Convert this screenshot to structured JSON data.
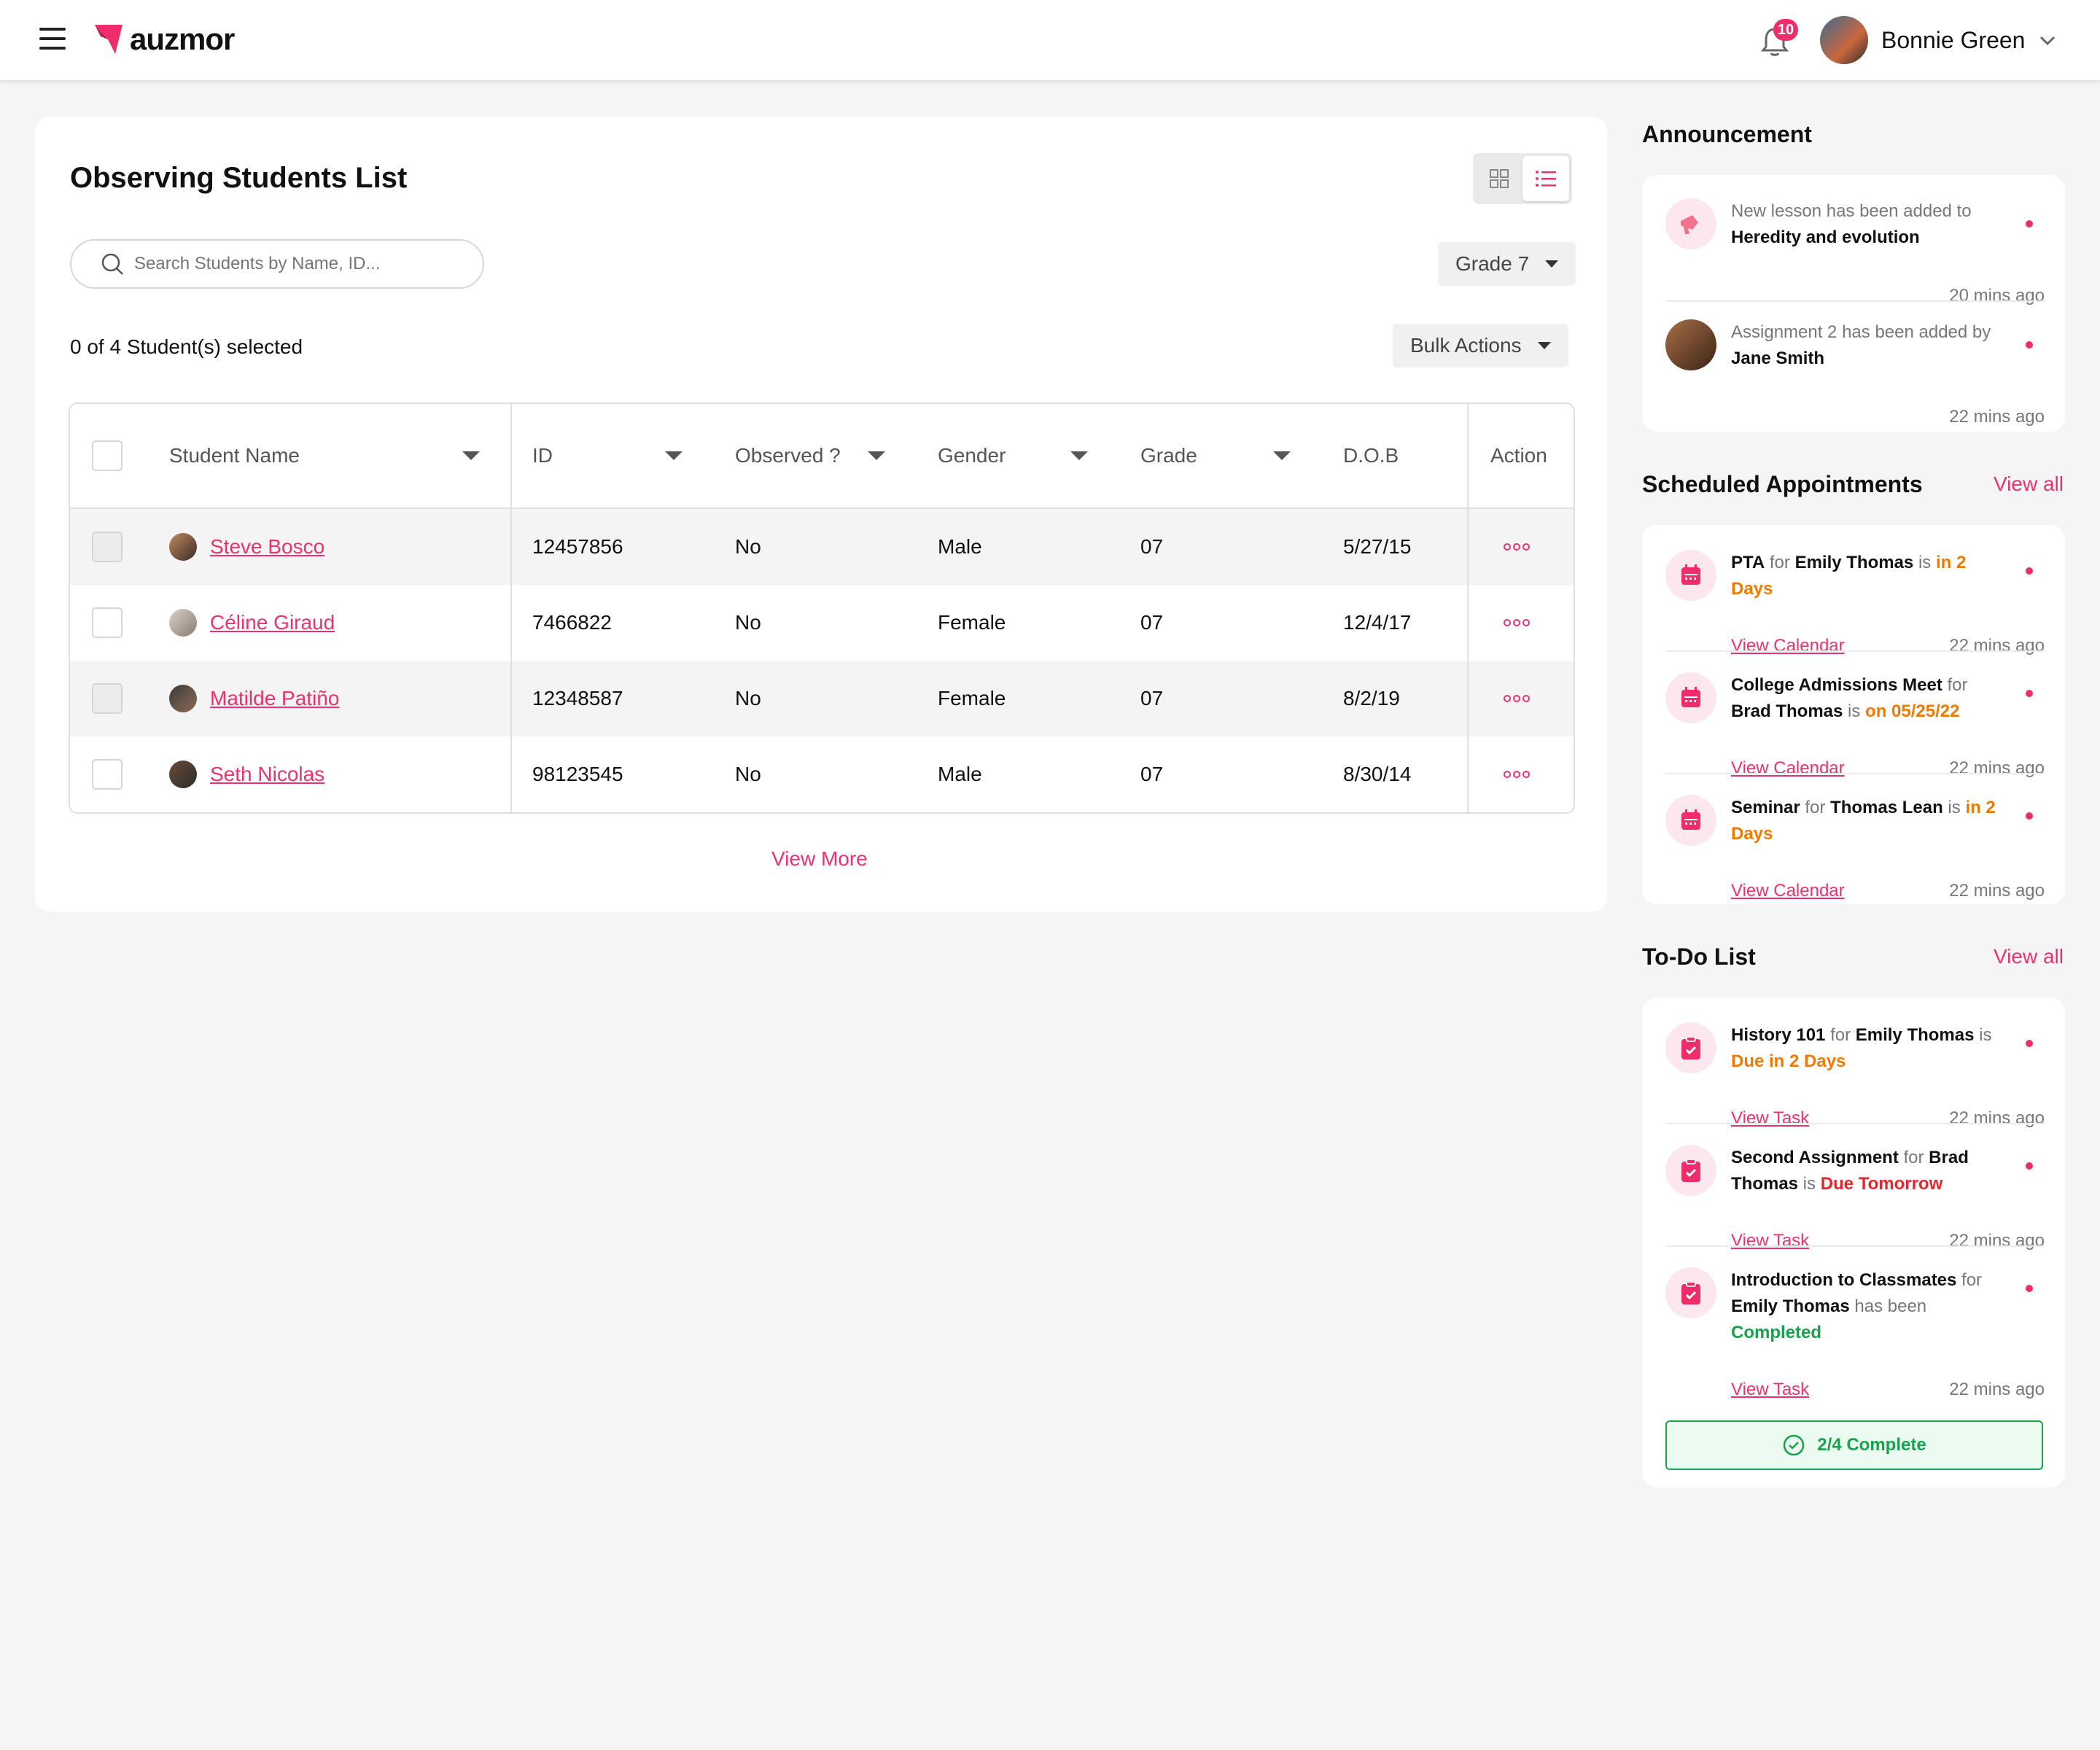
{
  "header": {
    "brand": "auzmor",
    "notification_count": "10",
    "user_name": "Bonnie Green"
  },
  "main": {
    "title": "Observing Students List",
    "search_placeholder": "Search Students by Name, ID...",
    "grade_filter": "Grade 7",
    "selected_text": "0 of 4 Student(s) selected",
    "bulk_actions": "Bulk Actions",
    "columns": [
      "Student Name",
      "ID",
      "Observed ?",
      "Gender",
      "Grade",
      "D.O.B",
      "Action"
    ],
    "students": [
      {
        "name": "Steve Bosco",
        "id": "12457856",
        "observed": "No",
        "gender": "Male",
        "grade": "07",
        "dob": "5/27/15"
      },
      {
        "name": "Céline Giraud",
        "id": "7466822",
        "observed": "No",
        "gender": "Female",
        "grade": "07",
        "dob": "12/4/17"
      },
      {
        "name": "Matilde Patiño",
        "id": "12348587",
        "observed": "No",
        "gender": "Female",
        "grade": "07",
        "dob": "8/2/19"
      },
      {
        "name": "Seth Nicolas",
        "id": "98123545",
        "observed": "No",
        "gender": "Male",
        "grade": "07",
        "dob": "8/30/14"
      }
    ],
    "view_more": "View More"
  },
  "announcement": {
    "title": "Announcement",
    "items": [
      {
        "pre": "New lesson has been added to ",
        "strong": "Heredity and evolution",
        "time": "20 mins ago",
        "icon": "megaphone-icon"
      },
      {
        "pre": "Assignment 2 has been added by ",
        "strong": "Jane Smith",
        "time": "22 mins ago",
        "icon": "avatar"
      }
    ]
  },
  "appointments": {
    "title": "Scheduled Appointments",
    "view_all": "View all",
    "items": [
      {
        "event": "PTA",
        "for": " for ",
        "person": "Emily Thomas",
        "is": " is ",
        "when": "in 2 Days",
        "link": "View Calendar",
        "time": "22 mins ago"
      },
      {
        "event": "College Admissions Meet",
        "for": " for ",
        "person": "Brad Thomas",
        "is": " is ",
        "when": "on 05/25/22",
        "link": "View Calendar",
        "time": "22 mins ago"
      },
      {
        "event": "Seminar",
        "for": " for ",
        "person": "Thomas Lean",
        "is": " is ",
        "when": "in 2 Days",
        "link": "View Calendar",
        "time": "22 mins ago"
      }
    ]
  },
  "todo": {
    "title": "To-Do List",
    "view_all": "View all",
    "items": [
      {
        "task": "History 101",
        "for": " for ",
        "person": "Emily Thomas",
        "is": " is ",
        "status": "Due in 2 Days",
        "link": "View Task",
        "time": "22 mins ago"
      },
      {
        "task": "Second Assignment",
        "for": " for ",
        "person": "Brad Thomas",
        "is": " is ",
        "status": "Due Tomorrow",
        "link": "View Task",
        "time": "22 mins ago"
      },
      {
        "task": "Introduction to Classmates",
        "for": " for ",
        "person": "Emily Thomas",
        "is": " has been ",
        "status": "Completed",
        "link": "View Task",
        "time": "22 mins ago"
      }
    ],
    "progress_label": "2/4 Complete"
  },
  "colors": {
    "accent": "#e8336f",
    "orange": "#ee7b00",
    "red": "#e4262d",
    "green": "#16a14a"
  }
}
